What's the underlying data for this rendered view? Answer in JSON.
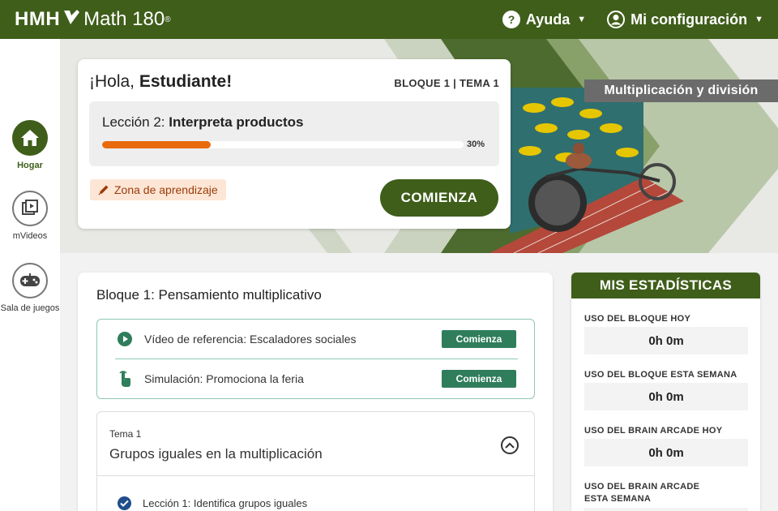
{
  "header": {
    "logo_brand": "HMH",
    "logo_product": "Math 180",
    "logo_reg": "®",
    "help_label": "Ayuda",
    "settings_label": "Mi configuración"
  },
  "sidebar": {
    "items": [
      {
        "label": "Hogar",
        "icon": "home-icon",
        "active": true
      },
      {
        "label": "mVideos",
        "icon": "video-library-icon",
        "active": false
      },
      {
        "label": "Sala de juegos",
        "icon": "gamepad-icon",
        "active": false
      }
    ]
  },
  "hero": {
    "badge": "Multiplicación y división"
  },
  "welcome": {
    "greeting_prefix": "¡Hola, ",
    "greeting_name": "Estudiante!",
    "block_tema": "BLOQUE 1 | TEMA 1",
    "lesson_prefix": "Lección 2: ",
    "lesson_name": "Interpreta productos",
    "progress": 0.3,
    "progress_label": "30%",
    "zone_label": "Zona de aprendizaje",
    "start_label": "COMIENZA"
  },
  "block": {
    "title": "Bloque 1: Pensamiento multiplicativo",
    "references": [
      {
        "text": "Vídeo de referencia: Escaladores sociales",
        "icon": "play-circle-icon",
        "button": "Comienza"
      },
      {
        "text": "Simulación: Promociona la feria",
        "icon": "touch-icon",
        "button": "Comienza"
      }
    ],
    "tema": {
      "number": "Tema 1",
      "name": "Grupos iguales en la multiplicación",
      "lessons": [
        {
          "text": "Lección 1: Identifica grupos iguales",
          "done": true
        }
      ]
    }
  },
  "stats": {
    "title": "MIS ESTADÍSTICAS",
    "items": [
      {
        "label": "USO DEL BLOQUE HOY",
        "value": "0h 0m"
      },
      {
        "label": "USO DEL BLOQUE ESTA SEMANA",
        "value": "0h 0m"
      },
      {
        "label": "USO DEL BRAIN ARCADE HOY",
        "value": "0h 0m"
      },
      {
        "label": "USO DEL BRAIN ARCADE ESTA SEMANA",
        "value": ""
      }
    ]
  },
  "colors": {
    "brand_green": "#3f5e1a",
    "progress_orange": "#e86a0c",
    "button_teal": "#2f7d5b"
  }
}
